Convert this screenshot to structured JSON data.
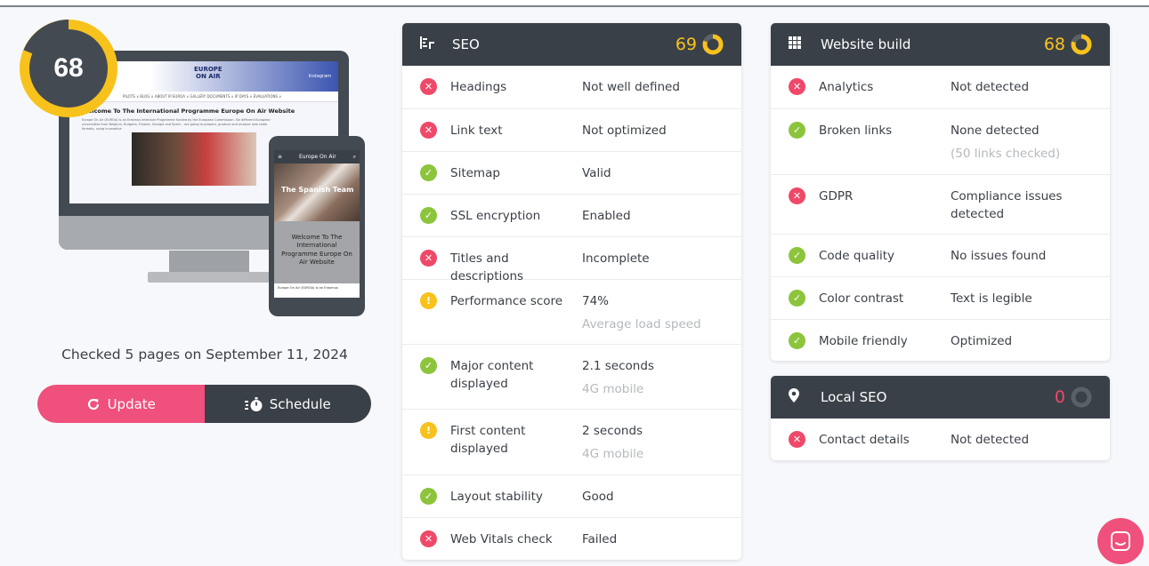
{
  "overall": {
    "score": "68"
  },
  "preview": {
    "site_logo_line1": "EUROPE",
    "site_logo_line2": "ON AIR",
    "site_insta": "Instagram",
    "site_nav": "PILOTS ∨   BLOG ∨   ABOUT IP EUROA ∨   GALLERY   DOCUMENTS ∨   IP DAYS ∨   EVALUATIONS ∨",
    "site_title": "Welcome To The International Programme Europe On Air Website",
    "site_text": "Europe On Air (EUROA) is an Erasmus Intensive Programme funded by the European Commission. Six different European universities from Belgium, Bulgaria, Finland, Georgia and Spain – are going to prepare, produce and analyze new radio formats, using innovative",
    "phone_title": "Europe On Air",
    "phone_photo_caption": "The Spanish Team",
    "phone_hero": "Welcome To The International Programme Europe On Air Website",
    "phone_foot": "Europe On Air (EUROA) is an Erasmus"
  },
  "checked_text": "Checked 5 pages on September 11, 2024",
  "buttons": {
    "update": "Update",
    "schedule": "Schedule"
  },
  "seo": {
    "title": "SEO",
    "score": "69",
    "score_color": "#f8c21c",
    "rows": [
      {
        "status": "fail",
        "label": "Headings",
        "value": "Not well defined",
        "sub": ""
      },
      {
        "status": "fail",
        "label": "Link text",
        "value": "Not optimized",
        "sub": ""
      },
      {
        "status": "pass",
        "label": "Sitemap",
        "value": "Valid",
        "sub": ""
      },
      {
        "status": "pass",
        "label": "SSL encryption",
        "value": "Enabled",
        "sub": ""
      },
      {
        "status": "fail",
        "label": "Titles and descriptions",
        "value": "Incomplete",
        "sub": ""
      },
      {
        "status": "warn",
        "label": "Performance score",
        "value": "74%",
        "sub": "Average load speed"
      },
      {
        "status": "pass",
        "label": "Major content displayed",
        "value": "2.1 seconds",
        "sub": "4G mobile"
      },
      {
        "status": "warn",
        "label": "First content displayed",
        "value": "2 seconds",
        "sub": "4G mobile"
      },
      {
        "status": "pass",
        "label": "Layout stability",
        "value": "Good",
        "sub": ""
      },
      {
        "status": "fail",
        "label": "Web Vitals check",
        "value": "Failed",
        "sub": ""
      }
    ]
  },
  "website_build": {
    "title": "Website build",
    "score": "68",
    "score_color": "#f8c21c",
    "rows": [
      {
        "status": "fail",
        "label": "Analytics",
        "value": "Not detected",
        "sub": ""
      },
      {
        "status": "pass",
        "label": "Broken links",
        "value": "None detected",
        "sub": "(50 links checked)"
      },
      {
        "status": "fail",
        "label": "GDPR",
        "value": "Compliance issues detected",
        "sub": ""
      },
      {
        "status": "pass",
        "label": "Code quality",
        "value": "No issues found",
        "sub": ""
      },
      {
        "status": "pass",
        "label": "Color contrast",
        "value": "Text is legible",
        "sub": ""
      },
      {
        "status": "pass",
        "label": "Mobile friendly",
        "value": "Optimized",
        "sub": ""
      }
    ]
  },
  "local_seo": {
    "title": "Local SEO",
    "score": "0",
    "score_color": "#ef4868",
    "rows": [
      {
        "status": "fail",
        "label": "Contact details",
        "value": "Not detected",
        "sub": ""
      }
    ]
  },
  "colors": {
    "fail": "#ef4868",
    "pass": "#8cc43c",
    "warn": "#f8c21c",
    "accent": "#f0507c",
    "dark": "#3a4048"
  }
}
